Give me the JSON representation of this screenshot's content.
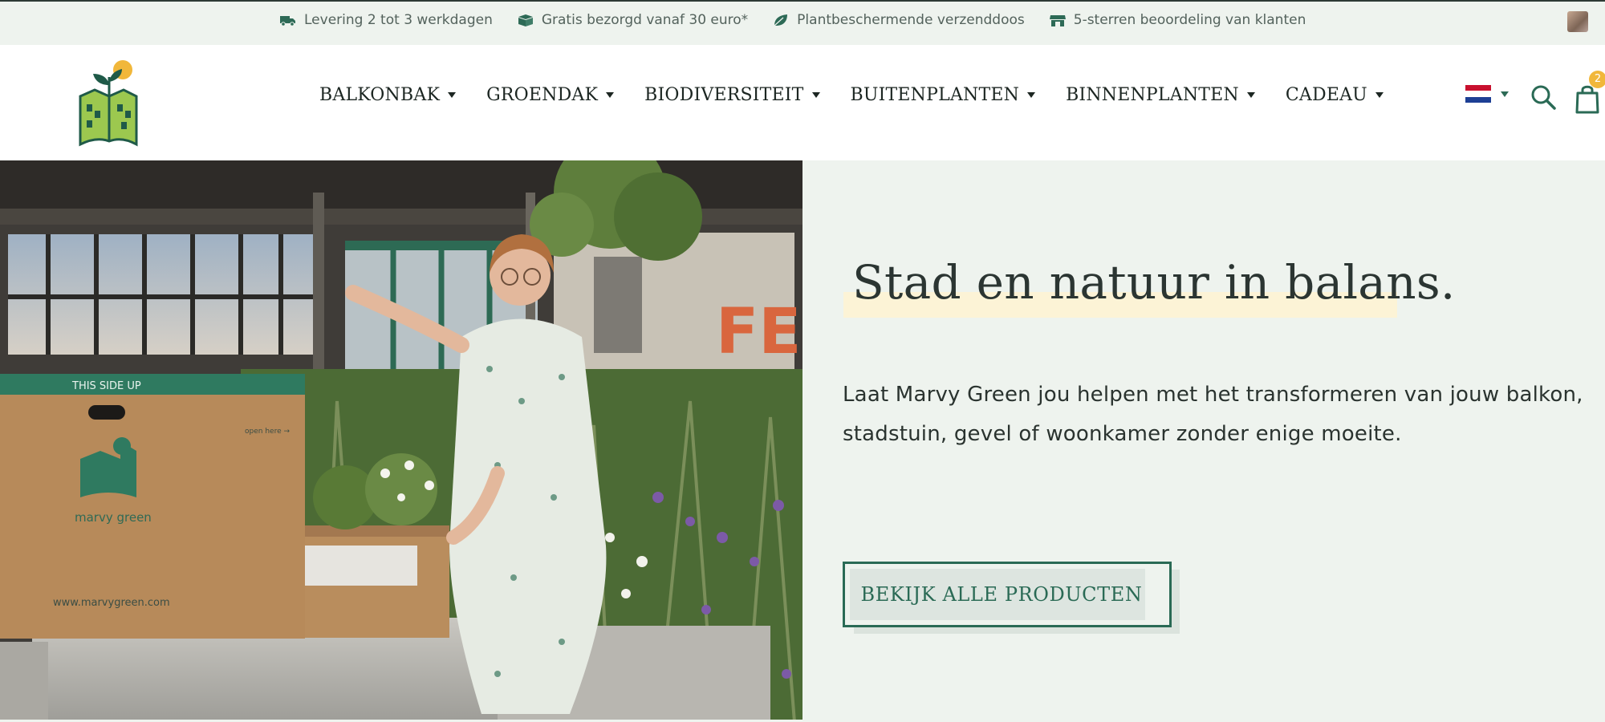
{
  "topbar": {
    "usps": [
      {
        "icon": "truck-icon",
        "text": "Levering 2 tot 3 werkdagen"
      },
      {
        "icon": "box-icon",
        "text": "Gratis bezorgd vanaf 30 euro*"
      },
      {
        "icon": "leaf-icon",
        "text": "Plantbeschermende verzenddoos"
      },
      {
        "icon": "store-icon",
        "text": "5-sterren beoordeling van klanten"
      }
    ]
  },
  "header": {
    "nav": [
      {
        "label": "BALKONBAK"
      },
      {
        "label": "GROENDAK"
      },
      {
        "label": "BIODIVERSITEIT"
      },
      {
        "label": "BUITENPLANTEN"
      },
      {
        "label": "BINNENPLANTEN"
      },
      {
        "label": "CADEAU"
      }
    ],
    "language_flag": "netherlands-flag-icon",
    "cart_count": "2"
  },
  "hero": {
    "headline": "Stad en natuur in balans.",
    "lead": "Laat Marvy Green jou helpen met het transformeren van jouw balkon, stadstuin, gevel of woonkamer zonder enige moeite.",
    "cta_label": "BEKIJK ALLE PRODUCTEN",
    "photo": {
      "box_top_label": "THIS SIDE UP",
      "box_open_label": "open here →",
      "box_brand": "marvy green",
      "box_url": "www.marvygreen.com",
      "sign_text": "FEN"
    }
  },
  "colors": {
    "brand_green": "#2a6a55",
    "hero_bg": "#eef3ee",
    "highlight": "#fcf3d6",
    "badge": "#f1b73a"
  }
}
